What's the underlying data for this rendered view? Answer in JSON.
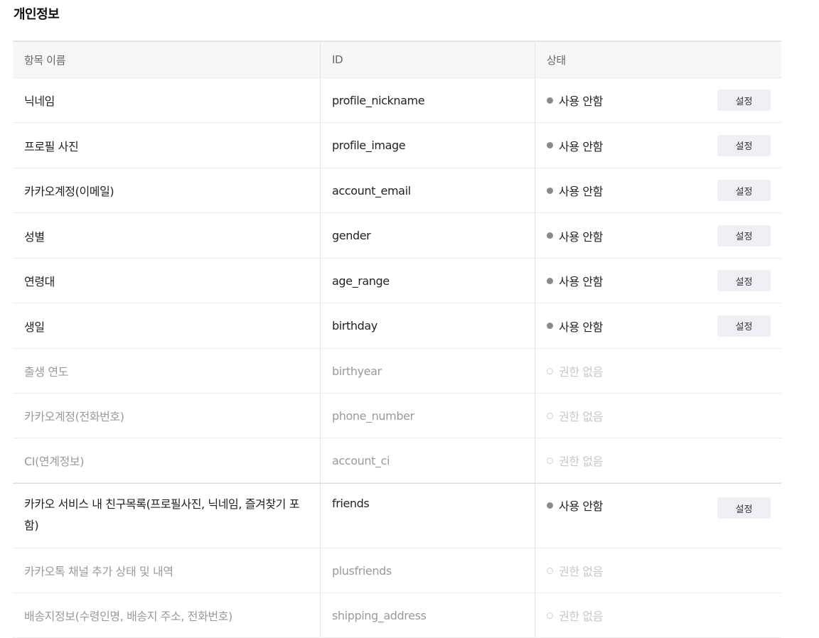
{
  "section": {
    "title": "개인정보"
  },
  "table": {
    "headers": {
      "name": "항목 이름",
      "id": "ID",
      "status": "상태"
    },
    "rows": [
      {
        "name": "닉네임",
        "id": "profile_nickname",
        "status": "사용 안함",
        "button": "설정"
      },
      {
        "name": "프로필 사진",
        "id": "profile_image",
        "status": "사용 안함",
        "button": "설정"
      },
      {
        "name": "카카오계정(이메일)",
        "id": "account_email",
        "status": "사용 안함",
        "button": "설정"
      },
      {
        "name": "성별",
        "id": "gender",
        "status": "사용 안함",
        "button": "설정"
      },
      {
        "name": "연령대",
        "id": "age_range",
        "status": "사용 안함",
        "button": "설정"
      },
      {
        "name": "생일",
        "id": "birthday",
        "status": "사용 안함",
        "button": "설정"
      },
      {
        "name": "출생 연도",
        "id": "birthyear",
        "status": "권한 없음"
      },
      {
        "name": "카카오계정(전화번호)",
        "id": "phone_number",
        "status": "권한 없음"
      },
      {
        "name": "CI(연계정보)",
        "id": "account_ci",
        "status": "권한 없음"
      },
      {
        "name": "카카오 서비스 내 친구목록(프로필사진, 닉네임, 즐겨찾기 포함)",
        "id": "friends",
        "status": "사용 안함",
        "button": "설정"
      },
      {
        "name": "카카오톡 채널 추가 상태 및 내역",
        "id": "plusfriends",
        "status": "권한 없음"
      },
      {
        "name": "배송지정보(수령인명, 배송지 주소, 전화번호)",
        "id": "shipping_address",
        "status": "권한 없음"
      }
    ]
  }
}
